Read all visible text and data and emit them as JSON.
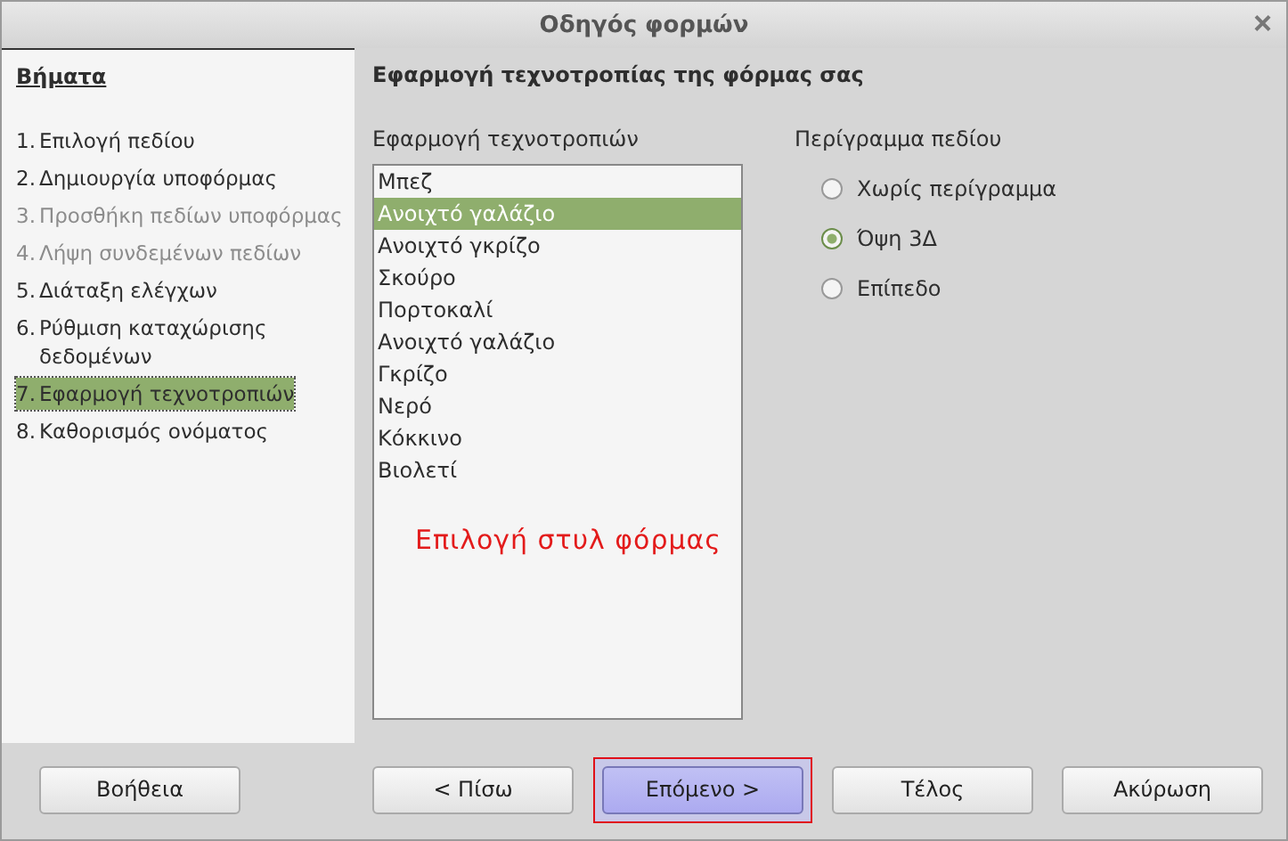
{
  "window": {
    "title": "Οδηγός φορμών",
    "close": "×"
  },
  "sidebar": {
    "heading": "Βήματα",
    "steps": [
      {
        "number": "1.",
        "label": "Επιλογή πεδίου",
        "disabled": false,
        "selected": false
      },
      {
        "number": "2.",
        "label": "Δημιουργία υποφόρμας",
        "disabled": false,
        "selected": false
      },
      {
        "number": "3.",
        "label": "Προσθήκη πεδίων υποφόρμας",
        "disabled": true,
        "selected": false
      },
      {
        "number": "4.",
        "label": "Λήψη συνδεμένων πεδίων",
        "disabled": true,
        "selected": false
      },
      {
        "number": "5.",
        "label": "Διάταξη ελέγχων",
        "disabled": false,
        "selected": false
      },
      {
        "number": "6.",
        "label": "Ρύθμιση καταχώρισης δεδομένων",
        "disabled": false,
        "selected": false
      },
      {
        "number": "7.",
        "label": "Εφαρμογή τεχνοτροπιών",
        "disabled": false,
        "selected": true
      },
      {
        "number": "8.",
        "label": "Καθορισμός ονόματος",
        "disabled": false,
        "selected": false
      }
    ]
  },
  "page": {
    "title": "Εφαρμογή τεχνοτροπίας της φόρμας σας",
    "styles": {
      "label": "Εφαρμογή τεχνοτροπιών",
      "items": [
        {
          "label": "Μπεζ",
          "selected": false
        },
        {
          "label": "Ανοιχτό γαλάζιο",
          "selected": true
        },
        {
          "label": "Ανοιχτό γκρίζο",
          "selected": false
        },
        {
          "label": "Σκούρο",
          "selected": false
        },
        {
          "label": "Πορτοκαλί",
          "selected": false
        },
        {
          "label": "Ανοιχτό γαλάζιο",
          "selected": false
        },
        {
          "label": "Γκρίζο",
          "selected": false
        },
        {
          "label": "Νερό",
          "selected": false
        },
        {
          "label": "Κόκκινο",
          "selected": false
        },
        {
          "label": "Βιολετί",
          "selected": false
        }
      ],
      "annotation": "Επιλογή στυλ φόρμας"
    },
    "border": {
      "label": "Περίγραμμα πεδίου",
      "options": [
        {
          "label": "Χωρίς περίγραμμα",
          "selected": false
        },
        {
          "label": "Όψη 3Δ",
          "selected": true
        },
        {
          "label": "Επίπεδο",
          "selected": false
        }
      ]
    }
  },
  "buttons": [
    {
      "label": "Βοήθεια",
      "kind": "help",
      "highlighted": false
    },
    {
      "label": "< Πίσω",
      "kind": "nav",
      "highlighted": false
    },
    {
      "label": "Επόμενο >",
      "kind": "default",
      "highlighted": true
    },
    {
      "label": "Τέλος",
      "kind": "nav",
      "highlighted": false
    },
    {
      "label": "Ακύρωση",
      "kind": "nav",
      "highlighted": false
    }
  ]
}
